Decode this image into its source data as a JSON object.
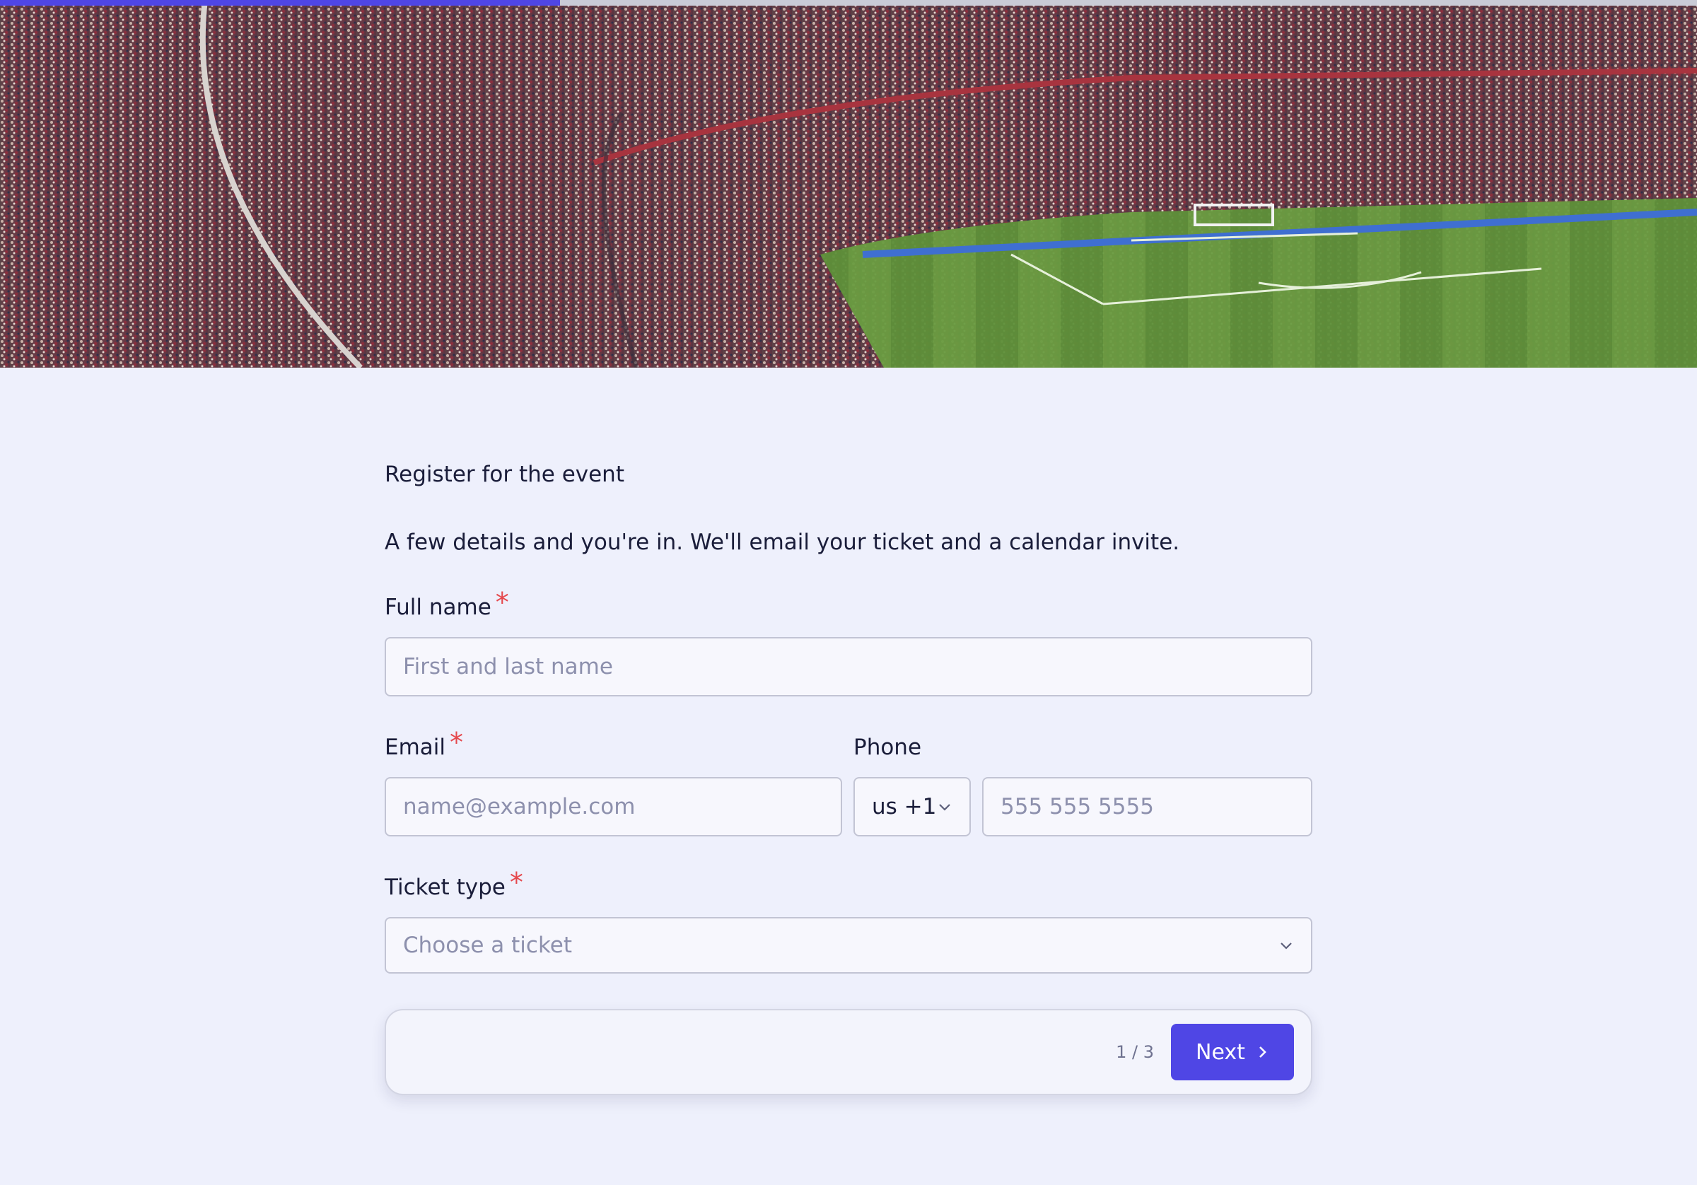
{
  "progress": {
    "value": 0.33
  },
  "hero": {
    "image": "stadium-crowd-photo",
    "description_icon": "stadium-image"
  },
  "form": {
    "title": "Register for the event",
    "subtitle": "A few details and you're in. We'll email your ticket and a calendar invite.",
    "required_mark": "*",
    "full_name": {
      "label": "Full name",
      "placeholder": "First and last name",
      "required": true
    },
    "email": {
      "label": "Email",
      "placeholder": "name@example.com",
      "required": true
    },
    "phone": {
      "label": "Phone",
      "country_code": "us +1",
      "placeholder": "555 555 5555",
      "required": false
    },
    "ticket_type": {
      "label": "Ticket type",
      "placeholder": "Choose a ticket",
      "required": true
    }
  },
  "footer": {
    "page_indicator": "1 / 3",
    "next_label": "Next"
  },
  "colors": {
    "accent": "#4f46e5",
    "background": "#eef0fc",
    "required": "#e5484d"
  }
}
